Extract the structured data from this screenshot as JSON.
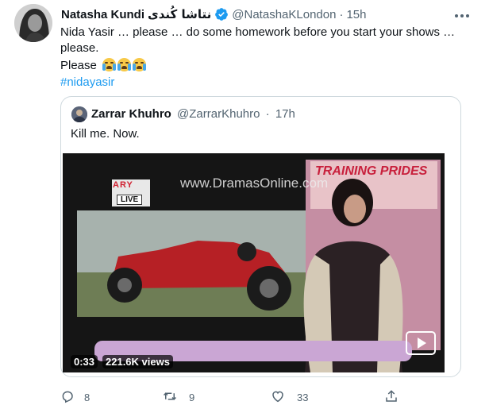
{
  "tweet": {
    "author_name": "Natasha Kundi",
    "author_name_urdu": "نتاشا کُندی",
    "handle": "@NatashaKLondon",
    "separator": "·",
    "time": "15h",
    "text_line1": "Nida Yasir … please … do some homework before you start your shows …",
    "text_line2": "please.",
    "text_line3": "Please",
    "hashtag": "#nidayasir"
  },
  "quoted": {
    "author_name": "Zarrar Khuhro",
    "handle": "@ZarrarKhuhro",
    "separator": "·",
    "time": "17h",
    "text": "Kill me. Now.",
    "video": {
      "watermark": "www.DramasOnline.com",
      "channel_logo": "ARY",
      "live_badge": "LIVE",
      "banner": "TRAINING PRIDES",
      "duration": "0:33",
      "views": "221.6K views"
    }
  },
  "actions": {
    "reply_count": "8",
    "retweet_count": "9",
    "like_count": "33"
  },
  "colors": {
    "accent": "#1d9bf0",
    "secondary_text": "#536471",
    "border": "#cfd9de"
  },
  "icons": [
    "verified-badge-icon",
    "more-icon",
    "reply-icon",
    "retweet-icon",
    "like-icon",
    "share-icon",
    "play-icon"
  ]
}
